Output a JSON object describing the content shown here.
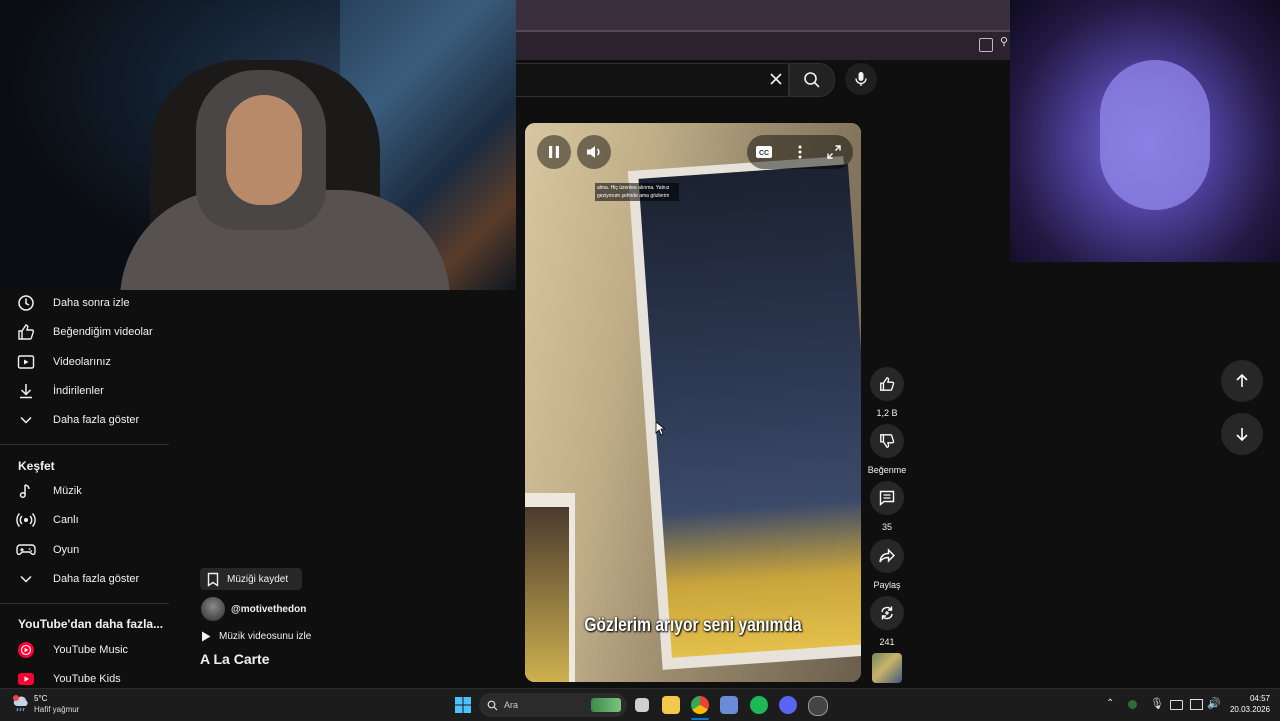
{
  "browser": {
    "icons": [
      "cast-icon",
      "zoom-icon"
    ]
  },
  "search": {
    "value": "",
    "icons": [
      "clear-icon",
      "search-icon",
      "microphone-icon"
    ]
  },
  "sidebar": {
    "you_items": [
      {
        "label": "Daha sonra izle",
        "icon": "clock-icon"
      },
      {
        "label": "Beğendiğim videolar",
        "icon": "thumbs-up-icon"
      },
      {
        "label": "Videolarınız",
        "icon": "play-square-icon"
      },
      {
        "label": "İndirilenler",
        "icon": "download-icon"
      },
      {
        "label": "Daha fazla göster",
        "icon": "chevron-down-icon"
      }
    ],
    "explore_title": "Keşfet",
    "explore_items": [
      {
        "label": "Müzik",
        "icon": "music-note-icon"
      },
      {
        "label": "Canlı",
        "icon": "live-icon"
      },
      {
        "label": "Oyun",
        "icon": "gamepad-icon"
      },
      {
        "label": "Daha fazla göster",
        "icon": "chevron-down-icon"
      }
    ],
    "more_title": "YouTube'dan daha fazla...",
    "more_items": [
      {
        "label": "YouTube Music",
        "icon": "youtube-music-icon"
      },
      {
        "label": "YouTube Kids",
        "icon": "youtube-kids-icon"
      }
    ]
  },
  "video": {
    "overlay_text_line1": "alma. Hiç üzenlee alınma. Yalnız",
    "overlay_text_line2": "geziyorum şehirde ama gözlerim",
    "caption": "Gözlerim arıyor seni yanımda",
    "controls": [
      "pause-icon",
      "volume-icon",
      "cc-icon",
      "more-icon",
      "fullscreen-icon"
    ]
  },
  "actions": {
    "like_count": "1,2 B",
    "dislike_label": "Beğenme",
    "comment_count": "35",
    "share_label": "Paylaş",
    "remix_count": "241"
  },
  "music": {
    "save_label": "Müziği kaydet",
    "channel": "@motivethedon",
    "watch_music_video": "Müzik videosunu izle",
    "song_title": "A La Carte"
  },
  "taskbar": {
    "weather_temp": "5°C",
    "weather_desc": "Hafif yağmur",
    "search_placeholder": "Ara",
    "time": "04:57",
    "date": "20.03.2026",
    "accent": "#0078d4"
  }
}
